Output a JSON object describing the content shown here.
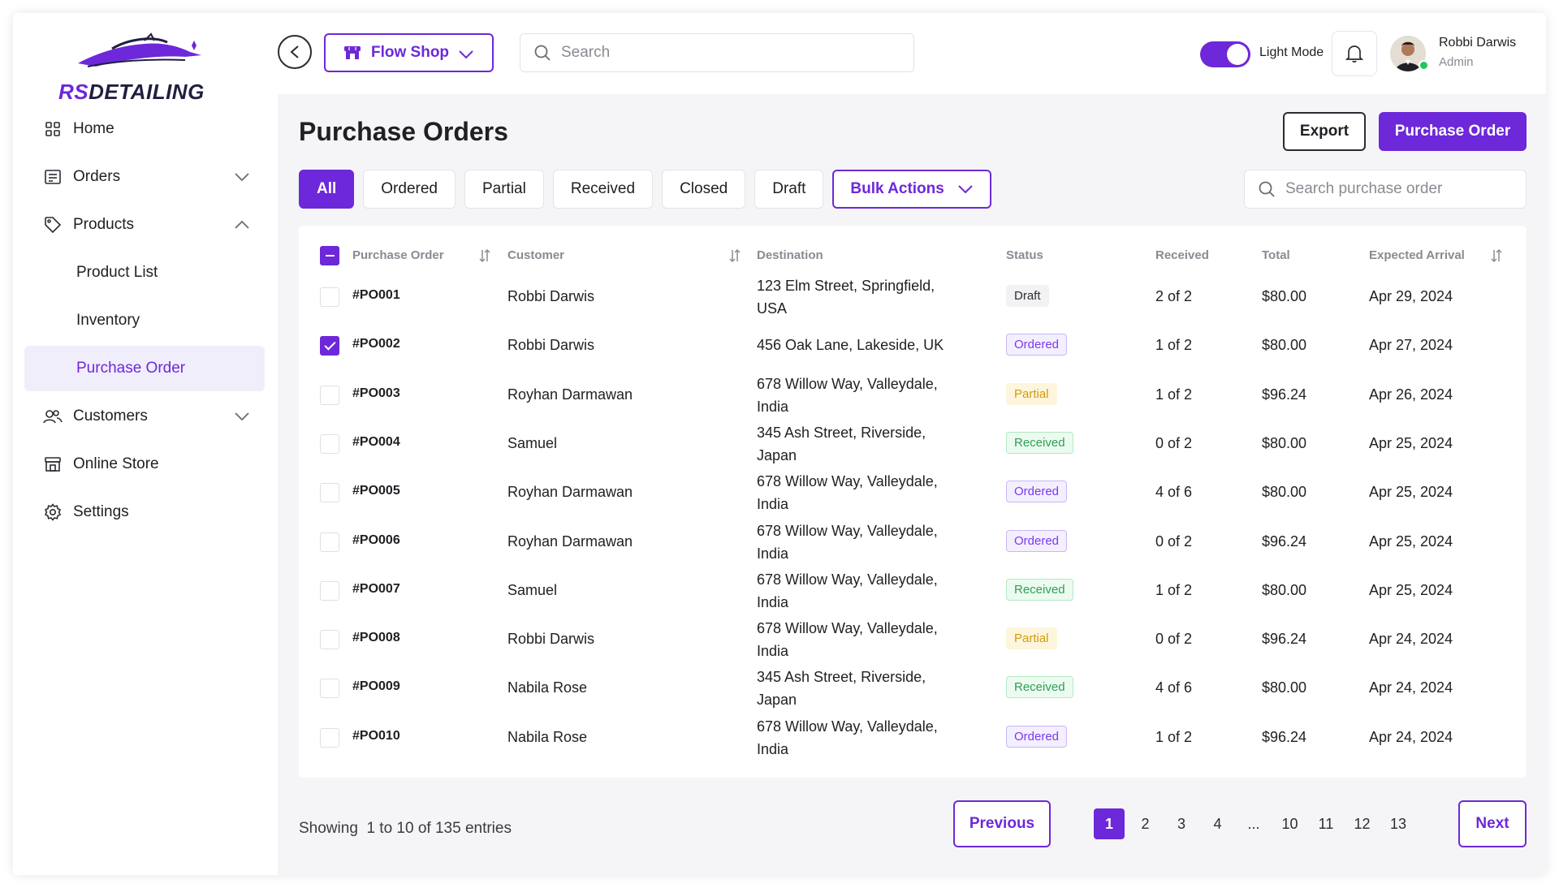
{
  "brand": {
    "logo_text_accent": "RS",
    "logo_text_rest": "DETAILING",
    "accent_color": "#6d28d9"
  },
  "sidebar": {
    "items": [
      {
        "label": "Home",
        "icon": "grid-icon"
      },
      {
        "label": "Orders",
        "icon": "receipt-icon",
        "chevron": "down"
      },
      {
        "label": "Products",
        "icon": "tag-icon",
        "chevron": "up"
      },
      {
        "label": "Product List",
        "sub": true
      },
      {
        "label": "Inventory",
        "sub": true
      },
      {
        "label": "Purchase Order",
        "sub": true,
        "active": true
      },
      {
        "label": "Customers",
        "icon": "users-icon",
        "chevron": "down"
      },
      {
        "label": "Online Store",
        "icon": "store-icon"
      },
      {
        "label": "Settings",
        "icon": "gear-icon"
      }
    ]
  },
  "header": {
    "shop_label": "Flow Shop",
    "search_placeholder": "Search",
    "mode_label": "Light Mode",
    "user_name": "Robbi Darwis",
    "user_role": "Admin"
  },
  "main": {
    "title": "Purchase Orders",
    "export_label": "Export",
    "create_label": "Purchase Order",
    "tabs": [
      "All",
      "Ordered",
      "Partial",
      "Received",
      "Closed",
      "Draft"
    ],
    "bulk_label": "Bulk Actions",
    "search_placeholder": "Search purchase order"
  },
  "table": {
    "columns": [
      "Purchase Order",
      "Customer",
      "Destination",
      "Status",
      "Received",
      "Total",
      "Expected Arrival"
    ],
    "rows": [
      {
        "po": "#PO001",
        "customer": "Robbi Darwis",
        "dest1": "123 Elm Street, Springfield,",
        "dest2": "USA",
        "status": "Draft",
        "status_class": "draft",
        "received": "2 of 2",
        "total": "$80.00",
        "arrival": "Apr 29, 2024",
        "checked": false
      },
      {
        "po": "#PO002",
        "customer": "Robbi Darwis",
        "dest1": "456 Oak Lane, Lakeside, UK",
        "dest2": "",
        "status": "Ordered",
        "status_class": "ordered",
        "received": "1 of 2",
        "total": "$80.00",
        "arrival": "Apr 27, 2024",
        "checked": true
      },
      {
        "po": "#PO003",
        "customer": "Royhan Darmawan",
        "dest1": "678 Willow Way, Valleydale,",
        "dest2": "India",
        "status": "Partial",
        "status_class": "partial",
        "received": "1 of 2",
        "total": "$96.24",
        "arrival": "Apr 26, 2024",
        "checked": false
      },
      {
        "po": "#PO004",
        "customer": "Samuel",
        "dest1": "345 Ash Street, Riverside,",
        "dest2": "Japan",
        "status": "Received",
        "status_class": "received",
        "received": "0 of 2",
        "total": "$80.00",
        "arrival": "Apr 25, 2024",
        "checked": false
      },
      {
        "po": "#PO005",
        "customer": "Royhan Darmawan",
        "dest1": "678 Willow Way, Valleydale,",
        "dest2": "India",
        "status": "Ordered",
        "status_class": "ordered",
        "received": "4 of 6",
        "total": "$80.00",
        "arrival": "Apr 25, 2024",
        "checked": false
      },
      {
        "po": "#PO006",
        "customer": "Royhan Darmawan",
        "dest1": "678 Willow Way, Valleydale,",
        "dest2": "India",
        "status": "Ordered",
        "status_class": "ordered",
        "received": "0 of 2",
        "total": "$96.24",
        "arrival": "Apr 25, 2024",
        "checked": false
      },
      {
        "po": "#PO007",
        "customer": "Samuel",
        "dest1": "678 Willow Way, Valleydale,",
        "dest2": "India",
        "status": "Received",
        "status_class": "received",
        "received": "1 of 2",
        "total": "$80.00",
        "arrival": "Apr 25, 2024",
        "checked": false
      },
      {
        "po": "#PO008",
        "customer": "Robbi Darwis",
        "dest1": "678 Willow Way, Valleydale,",
        "dest2": "India",
        "status": "Partial",
        "status_class": "partial",
        "received": "0 of 2",
        "total": "$96.24",
        "arrival": "Apr 24, 2024",
        "checked": false
      },
      {
        "po": "#PO009",
        "customer": "Nabila Rose",
        "dest1": "345 Ash Street, Riverside,",
        "dest2": "Japan",
        "status": "Received",
        "status_class": "received",
        "received": "4 of 6",
        "total": "$80.00",
        "arrival": "Apr 24, 2024",
        "checked": false
      },
      {
        "po": "#PO010",
        "customer": "Nabila Rose",
        "dest1": "678 Willow Way, Valleydale,",
        "dest2": "India",
        "status": "Ordered",
        "status_class": "ordered",
        "received": "1 of 2",
        "total": "$96.24",
        "arrival": "Apr 24, 2024",
        "checked": false
      }
    ]
  },
  "footer": {
    "showing_label": "Showing",
    "showing_range": "1 to 10 of 135 entries",
    "prev_label": "Previous",
    "next_label": "Next",
    "pages": [
      "1",
      "2",
      "3",
      "4",
      "...",
      "10",
      "11",
      "12",
      "13"
    ],
    "current_page": "1"
  }
}
